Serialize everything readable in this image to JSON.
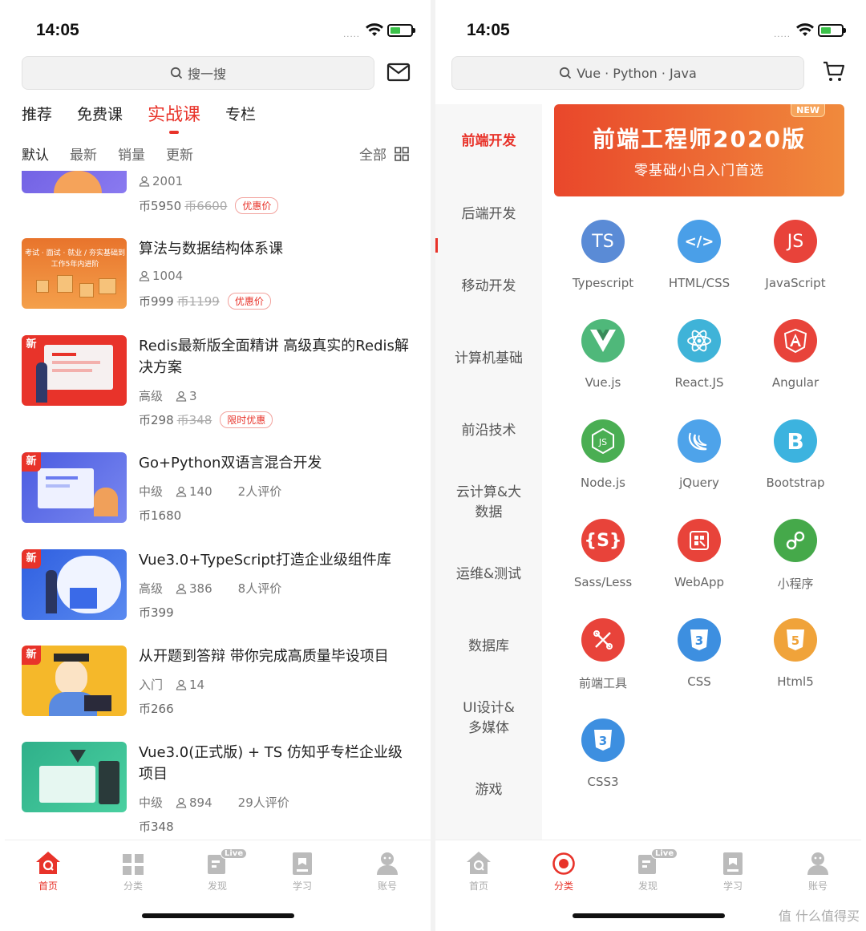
{
  "status": {
    "time": "14:05",
    "signal": "....."
  },
  "left": {
    "search_placeholder": "搜一搜",
    "tabs": [
      {
        "label": "推荐"
      },
      {
        "label": "免费课"
      },
      {
        "label": "实战课"
      },
      {
        "label": "专栏"
      }
    ],
    "sorts": [
      {
        "label": "默认"
      },
      {
        "label": "最新"
      },
      {
        "label": "销量"
      },
      {
        "label": "更新"
      }
    ],
    "all_label": "全部",
    "courses": [
      {
        "title": "",
        "is_new": false,
        "level": "",
        "students": "2001",
        "reviews": "",
        "price": "币5950",
        "original": "币6600",
        "badge": "优惠价"
      },
      {
        "title": "算法与数据结构体系课",
        "is_new": false,
        "level": "",
        "students": "1004",
        "reviews": "",
        "price": "币999",
        "original": "币1199",
        "badge": "优惠价",
        "thumb_text": "考试 · 面试 · 就业 / 夯实基础到工作5年内进阶"
      },
      {
        "title": "Redis最新版全面精讲 高级真实的Redis解决方案",
        "is_new": true,
        "level": "高级",
        "students": "3",
        "reviews": "",
        "price": "币298",
        "original": "币348",
        "badge": "限时优惠"
      },
      {
        "title": "Go+Python双语言混合开发",
        "is_new": true,
        "level": "中级",
        "students": "140",
        "reviews": "2人评价",
        "price": "币1680",
        "original": "",
        "badge": ""
      },
      {
        "title": "Vue3.0+TypeScript打造企业级组件库",
        "is_new": true,
        "level": "高级",
        "students": "386",
        "reviews": "8人评价",
        "price": "币399",
        "original": "",
        "badge": ""
      },
      {
        "title": "从开题到答辩 带你完成高质量毕设项目",
        "is_new": true,
        "level": "入门",
        "students": "14",
        "reviews": "",
        "price": "币266",
        "original": "",
        "badge": ""
      },
      {
        "title": "Vue3.0(正式版) + TS 仿知乎专栏企业级项目",
        "is_new": false,
        "level": "中级",
        "students": "894",
        "reviews": "29人评价",
        "price": "币348",
        "original": "",
        "badge": ""
      }
    ],
    "new_tag": "新"
  },
  "right": {
    "search_placeholder": "Vue · Python · Java",
    "sidebar": [
      {
        "label": "前端开发"
      },
      {
        "label": "后端开发"
      },
      {
        "label": "移动开发"
      },
      {
        "label": "计算机基础"
      },
      {
        "label": "前沿技术"
      },
      {
        "label": "云计算&大数据"
      },
      {
        "label": "运维&测试"
      },
      {
        "label": "数据库"
      },
      {
        "label": "UI设计&多媒体"
      },
      {
        "label": "游戏"
      }
    ],
    "banner": {
      "title": "前端工程师2020版",
      "subtitle": "零基础小白入门首选",
      "badge": "NEW"
    },
    "categories": [
      {
        "label": "Typescript",
        "glyph": "TS",
        "color": "#5a8bd6"
      },
      {
        "label": "HTML/CSS",
        "glyph": "</>",
        "color": "#4a9fe8"
      },
      {
        "label": "JavaScript",
        "glyph": "JS",
        "color": "#e8433a"
      },
      {
        "label": "Vue.js",
        "glyph": "",
        "color": "#4fb87a"
      },
      {
        "label": "React.JS",
        "glyph": "",
        "color": "#3fb3d8"
      },
      {
        "label": "Angular",
        "glyph": "",
        "color": "#e8433a"
      },
      {
        "label": "Node.js",
        "glyph": "",
        "color": "#4aae53"
      },
      {
        "label": "jQuery",
        "glyph": "",
        "color": "#4ea3ea"
      },
      {
        "label": "Bootstrap",
        "glyph": "B",
        "color": "#3cb3df"
      },
      {
        "label": "Sass/Less",
        "glyph": "{S}",
        "color": "#e8433a"
      },
      {
        "label": "WebApp",
        "glyph": "",
        "color": "#e8433a"
      },
      {
        "label": "小程序",
        "glyph": "",
        "color": "#45a94a"
      },
      {
        "label": "前端工具",
        "glyph": "",
        "color": "#e8433a"
      },
      {
        "label": "CSS",
        "glyph": "3",
        "color": "#3d8fe0"
      },
      {
        "label": "Html5",
        "glyph": "5",
        "color": "#f0a33a"
      },
      {
        "label": "CSS3",
        "glyph": "3",
        "color": "#3d8fe0"
      }
    ]
  },
  "tabbar": [
    {
      "label": "首页"
    },
    {
      "label": "分类"
    },
    {
      "label": "发现"
    },
    {
      "label": "学习"
    },
    {
      "label": "账号"
    }
  ],
  "live_badge": "Live",
  "watermark": "值 什么值得买",
  "colors": {
    "accent": "#e8332a",
    "inactive": "#aaaaaa"
  }
}
